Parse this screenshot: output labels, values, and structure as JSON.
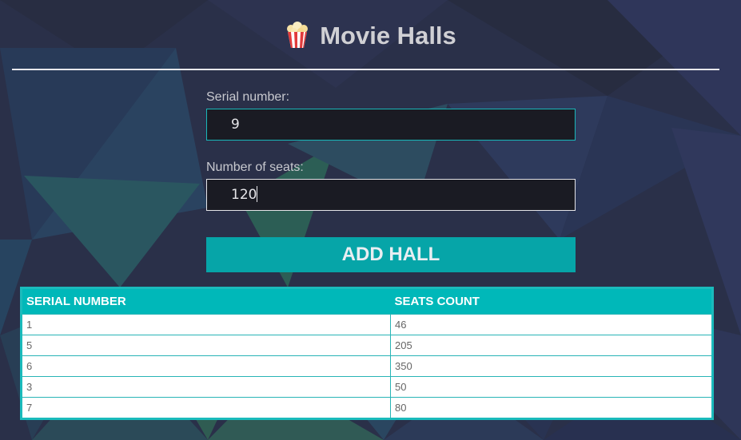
{
  "header": {
    "icon": "popcorn-icon",
    "title": "Movie Halls"
  },
  "form": {
    "serial_label": "Serial number:",
    "serial_value": "9",
    "seats_label": "Number of seats:",
    "seats_value": "120",
    "add_button_label": "ADD HALL"
  },
  "table": {
    "headers": [
      "SERIAL NUMBER",
      "SEATS COUNT"
    ],
    "rows": [
      [
        "1",
        "46"
      ],
      [
        "5",
        "205"
      ],
      [
        "6",
        "350"
      ],
      [
        "3",
        "50"
      ],
      [
        "7",
        "80"
      ]
    ]
  },
  "colors": {
    "accent": "#00b8b9",
    "button": "#06a5a8",
    "background": "#2b3148"
  }
}
